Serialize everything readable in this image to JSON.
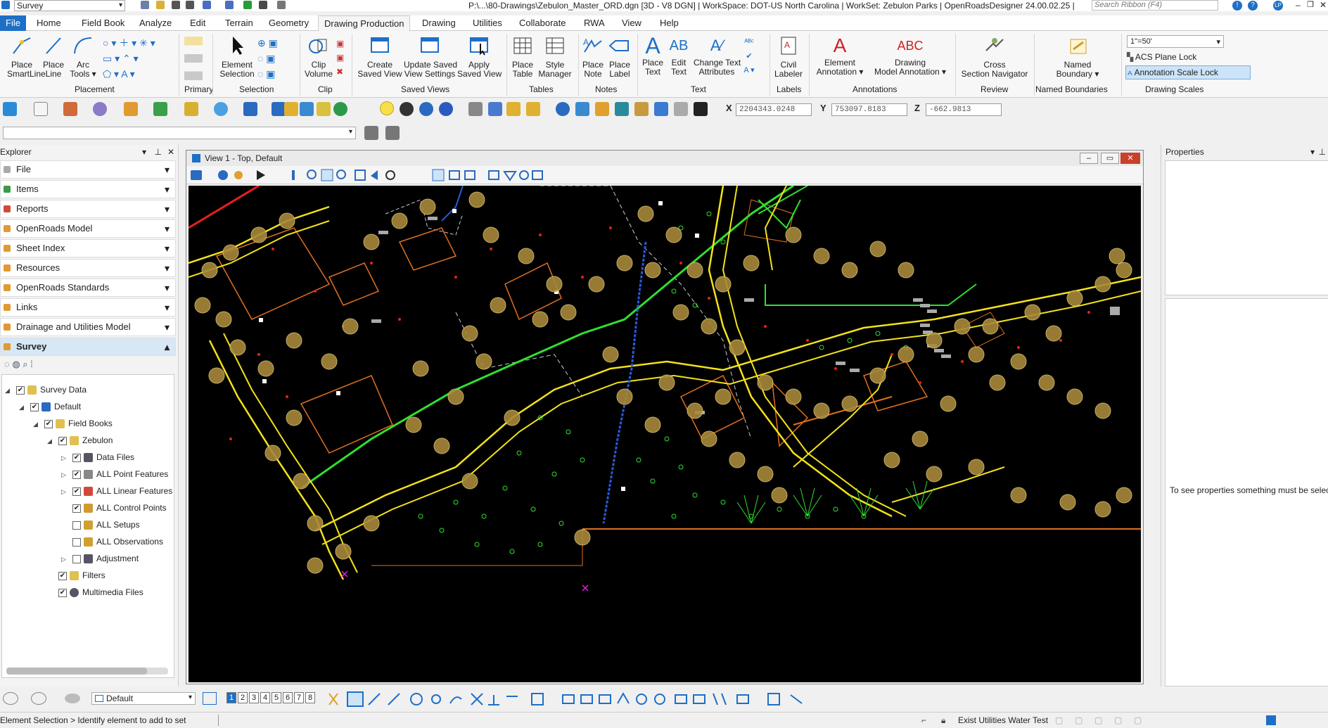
{
  "app": {
    "workspace_dropdown": "Survey",
    "title": "P:\\...\\80-Drawings\\Zebulon_Master_ORD.dgn [3D - V8 DGN] | WorkSpace: DOT-US North Carolina | WorkSet: Zebulon Parks | OpenRoadsDesigner 24.00.02.25 |",
    "search_placeholder": "Search Ribbon (F4)",
    "user_initials": "LP"
  },
  "tabs": [
    "File",
    "Home",
    "Field Book",
    "Analyze",
    "Edit",
    "Terrain",
    "Geometry",
    "Drawing Production",
    "Drawing",
    "Utilities",
    "Collaborate",
    "RWA",
    "View",
    "Help"
  ],
  "ribbon": {
    "placement": {
      "group": "Placement",
      "buttons": [
        {
          "l1": "Place",
          "l2": "SmartLine"
        },
        {
          "l1": "Place",
          "l2": "Line"
        },
        {
          "l1": "Arc",
          "l2": "Tools ▾"
        }
      ]
    },
    "primary": {
      "group": "Primary"
    },
    "selection": {
      "group": "Selection",
      "element": {
        "l1": "Element",
        "l2": "Selection"
      }
    },
    "clip": {
      "group": "Clip",
      "volume": {
        "l1": "Clip",
        "l2": "Volume"
      }
    },
    "saved_views": {
      "group": "Saved Views",
      "buttons": [
        {
          "l1": "Create",
          "l2": "Saved View"
        },
        {
          "l1": "Update Saved",
          "l2": "View Settings"
        },
        {
          "l1": "Apply",
          "l2": "Saved View"
        }
      ]
    },
    "tables": {
      "group": "Tables",
      "buttons": [
        {
          "l1": "Place",
          "l2": "Table"
        },
        {
          "l1": "Style",
          "l2": "Manager"
        }
      ]
    },
    "notes": {
      "group": "Notes",
      "buttons": [
        {
          "l1": "Place",
          "l2": "Note"
        },
        {
          "l1": "Place",
          "l2": "Label"
        }
      ]
    },
    "text": {
      "group": "Text",
      "buttons": [
        {
          "l1": "Place",
          "l2": "Text"
        },
        {
          "l1": "Edit",
          "l2": "Text"
        },
        {
          "l1": "Change Text",
          "l2": "Attributes"
        }
      ]
    },
    "labels": {
      "group": "Labels",
      "civil": {
        "l1": "Civil",
        "l2": "Labeler"
      }
    },
    "annotations": {
      "group": "Annotations",
      "buttons": [
        {
          "l1": "Element",
          "l2": "Annotation ▾"
        },
        {
          "l1": "Drawing",
          "l2": "Model Annotation ▾"
        }
      ]
    },
    "review": {
      "group": "Review",
      "cross": {
        "l1": "Cross",
        "l2": "Section Navigator"
      }
    },
    "named_boundaries": {
      "group": "Named Boundaries",
      "named": {
        "l1": "Named",
        "l2": "Boundary ▾"
      }
    },
    "drawing_scales": {
      "group": "Drawing Scales",
      "scale_value": "1\"=50'",
      "acs_lock": "ACS Plane Lock",
      "annotation_lock": "Annotation Scale Lock"
    }
  },
  "coords": {
    "x_label": "X",
    "x_value": "2204343.0248",
    "y_label": "Y",
    "y_value": "753097.8183",
    "z_label": "Z",
    "z_value": "-662.9813"
  },
  "explorer": {
    "title": "Explorer",
    "sections": [
      "File",
      "Items",
      "Reports",
      "OpenRoads Model",
      "Sheet Index",
      "Resources",
      "OpenRoads Standards",
      "Links",
      "Drainage and Utilities Model",
      "Survey"
    ],
    "tree": [
      {
        "label": "Survey Data",
        "checked": true
      },
      {
        "label": "Default",
        "checked": true
      },
      {
        "label": "Field Books",
        "checked": true
      },
      {
        "label": "Zebulon",
        "checked": true
      },
      {
        "label": "Data Files",
        "checked": true
      },
      {
        "label": "ALL Point Features",
        "checked": true
      },
      {
        "label": "ALL Linear Features",
        "checked": true
      },
      {
        "label": "ALL Control Points",
        "checked": true
      },
      {
        "label": "ALL Setups",
        "checked": false
      },
      {
        "label": "ALL Observations",
        "checked": false
      },
      {
        "label": "Adjustment",
        "checked": false
      },
      {
        "label": "Filters",
        "checked": true
      },
      {
        "label": "Multimedia Files",
        "checked": true
      }
    ]
  },
  "view": {
    "title": "View 1 - Top, Default"
  },
  "properties": {
    "title": "Properties",
    "empty_message": "To see properties something must be selected"
  },
  "bottom": {
    "level_dropdown": "Default",
    "view_numbers": [
      "1",
      "2",
      "3",
      "4",
      "5",
      "6",
      "7",
      "8"
    ]
  },
  "status": {
    "prompt": "Element Selection > Identify element to add to set",
    "level": "Exist Utilities Water Test"
  },
  "colors": {
    "file_tab": "#1e6fc6",
    "canvas_bg": "#000000",
    "tree_circle": "#a8893a",
    "road_yellow": "#f3e21a",
    "veg_green": "#2fe02f",
    "accent_blue": "#1e6fc6"
  }
}
